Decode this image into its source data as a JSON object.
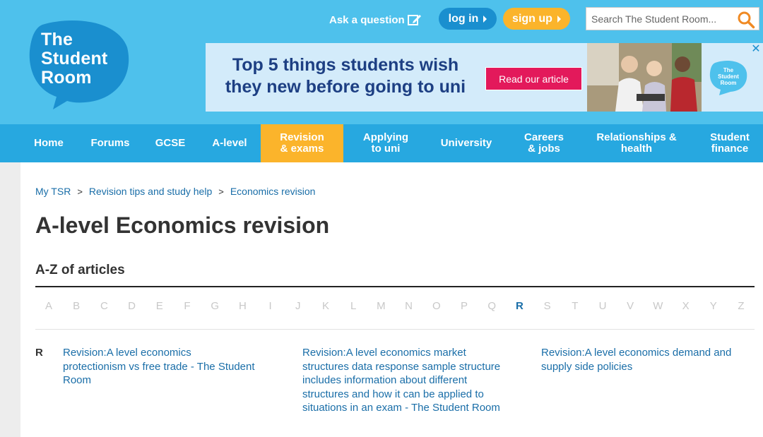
{
  "header": {
    "logo_lines": [
      "The",
      "Student",
      "Room"
    ],
    "ask_question": "Ask a question",
    "login": "log in",
    "signup": "sign up",
    "search_placeholder": "Search The Student Room..."
  },
  "ad": {
    "headline_line1": "Top 5 things students wish",
    "headline_line2": "they new before going to uni",
    "cta": "Read our article",
    "close": "✕"
  },
  "nav": [
    {
      "line1": "Home",
      "line2": ""
    },
    {
      "line1": "Forums",
      "line2": ""
    },
    {
      "line1": "GCSE",
      "line2": ""
    },
    {
      "line1": "A-level",
      "line2": ""
    },
    {
      "line1": "Revision",
      "line2": "& exams"
    },
    {
      "line1": "Applying",
      "line2": "to uni"
    },
    {
      "line1": "University",
      "line2": ""
    },
    {
      "line1": "Careers",
      "line2": "& jobs"
    },
    {
      "line1": "Relationships &",
      "line2": "health"
    },
    {
      "line1": "Student",
      "line2": "finance"
    }
  ],
  "breadcrumb": {
    "items": [
      "My TSR",
      "Revision tips and study help",
      "Economics revision"
    ],
    "separator": ">"
  },
  "page_title": "A-level Economics revision",
  "az_heading": "A-Z of articles",
  "alphabet": [
    "A",
    "B",
    "C",
    "D",
    "E",
    "F",
    "G",
    "H",
    "I",
    "J",
    "K",
    "L",
    "M",
    "N",
    "O",
    "P",
    "Q",
    "R",
    "S",
    "T",
    "U",
    "V",
    "W",
    "X",
    "Y",
    "Z"
  ],
  "active_letter": "R",
  "section_letter": "R",
  "articles": [
    "Revision:A level economics protectionism vs free trade - The Student Room",
    "Revision:A level economics market structures data response sample structure includes information about different structures and how it can be applied to situations in an exam - The Student Room",
    "Revision:A level economics demand and supply side policies"
  ],
  "colors": {
    "header_bg": "#4ec1ec",
    "nav_bg": "#27a8e0",
    "accent_yellow": "#fbb42b",
    "login_blue": "#1a8fcf",
    "link_blue": "#1a6ea8",
    "cta_pink": "#e3195b"
  }
}
